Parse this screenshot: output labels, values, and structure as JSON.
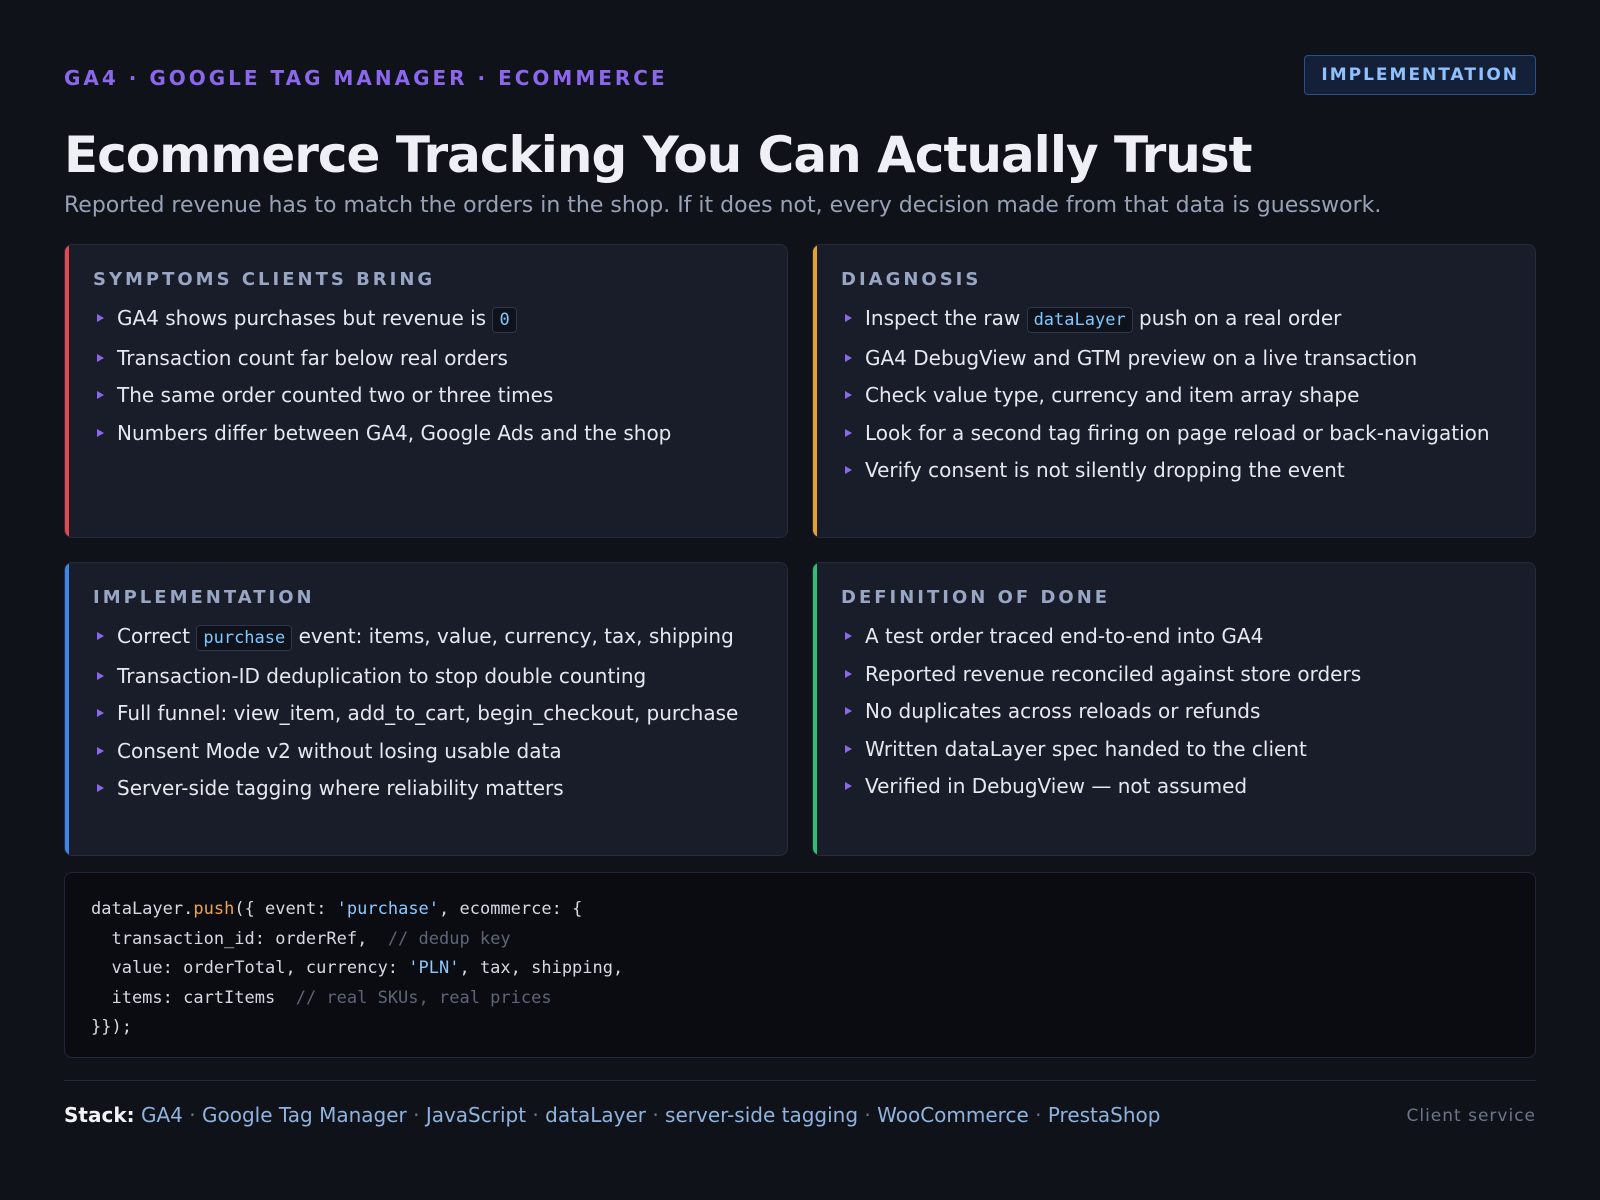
{
  "header": {
    "eyebrow": "GA4 · GOOGLE TAG MANAGER · ECOMMERCE",
    "badge": "IMPLEMENTATION",
    "title": "Ecommerce Tracking You Can Actually Trust",
    "subtitle": "Reported revenue has to match the orders in the shop. If it does not, every decision made from that data is guesswork."
  },
  "colors": {
    "symptoms": "#e5484d",
    "diagnosis": "#e5a32e",
    "implementation": "#3d85e6",
    "done": "#2fbf71",
    "bullet": "#8b67ec"
  },
  "cards": {
    "symptoms": {
      "heading": "SYMPTOMS CLIENTS BRING",
      "items": [
        {
          "before": "GA4 shows purchases but revenue is ",
          "code": "0",
          "after": ""
        },
        {
          "text": "Transaction count far below real orders"
        },
        {
          "text": "The same order counted two or three times"
        },
        {
          "text": "Numbers differ between GA4, Google Ads and the shop"
        }
      ]
    },
    "diagnosis": {
      "heading": "DIAGNOSIS",
      "items": [
        {
          "before": "Inspect the raw ",
          "code": "dataLayer",
          "after": " push on a real order"
        },
        {
          "text": "GA4 DebugView and GTM preview on a live transaction"
        },
        {
          "text": "Check value type, currency and item array shape"
        },
        {
          "text": "Look for a second tag firing on page reload or back-navigation"
        },
        {
          "text": "Verify consent is not silently dropping the event"
        }
      ]
    },
    "implementation": {
      "heading": "IMPLEMENTATION",
      "items": [
        {
          "before": "Correct ",
          "code": "purchase",
          "after": " event: items, value, currency, tax, shipping"
        },
        {
          "text": "Transaction-ID deduplication to stop double counting"
        },
        {
          "text": "Full funnel: view_item, add_to_cart, begin_checkout, purchase"
        },
        {
          "text": "Consent Mode v2 without losing usable data"
        },
        {
          "text": "Server-side tagging where reliability matters"
        }
      ]
    },
    "done": {
      "heading": "DEFINITION OF DONE",
      "items": [
        {
          "text": "A test order traced end-to-end into GA4"
        },
        {
          "text": "Reported revenue reconciled against store orders"
        },
        {
          "text": "No duplicates across reloads or refunds"
        },
        {
          "text": "Written dataLayer spec handed to the client"
        },
        {
          "text": "Verified in DebugView — not assumed"
        }
      ]
    }
  },
  "code": {
    "l1_a": "dataLayer.",
    "l1_fn": "push",
    "l1_b": "({ event: ",
    "l1_str": "'purchase'",
    "l1_c": ", ecommerce: {",
    "l2_a": "  transaction_id: orderRef,  ",
    "l2_cmt": "// dedup key",
    "l3_a": "  value: orderTotal, currency: ",
    "l3_str": "'PLN'",
    "l3_b": ", tax, shipping,",
    "l4_a": "  items: cartItems  ",
    "l4_cmt": "// real SKUs, real prices",
    "l5_a": "}});"
  },
  "footer": {
    "stack_label": "Stack:",
    "stack_items": [
      "GA4",
      "Google Tag Manager",
      "JavaScript",
      "dataLayer",
      "server-side tagging",
      "WooCommerce",
      "PrestaShop"
    ],
    "separator": " · ",
    "right": "Client service"
  }
}
